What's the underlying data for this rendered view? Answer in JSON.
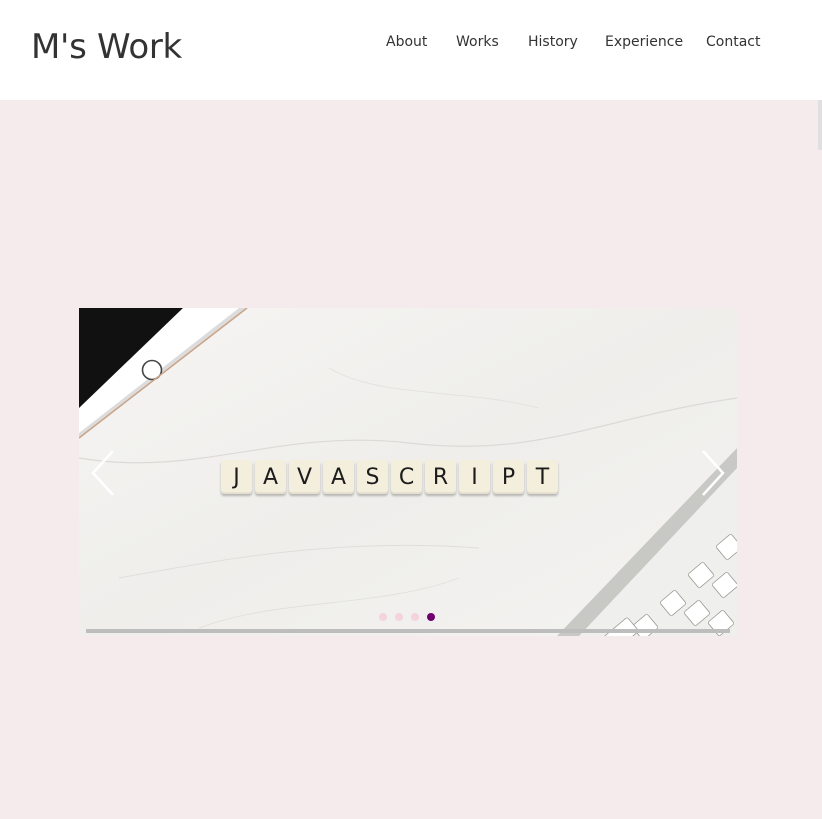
{
  "header": {
    "logo": "M's Work",
    "nav": [
      {
        "label": "About"
      },
      {
        "label": "Works"
      },
      {
        "label": "History"
      },
      {
        "label": "Experience"
      },
      {
        "label": "Contact"
      }
    ]
  },
  "slider": {
    "tile_letters": [
      "J",
      "A",
      "V",
      "A",
      "S",
      "C",
      "R",
      "I",
      "P",
      "T"
    ],
    "slides_total": 4,
    "active_slide": 4,
    "progress": 1.0,
    "colors": {
      "page_bg": "#f5ebec",
      "dot_inactive": "#f4d3dc",
      "dot_active": "#70006e"
    },
    "prev_icon": "chevron-left-icon",
    "next_icon": "chevron-right-icon"
  }
}
